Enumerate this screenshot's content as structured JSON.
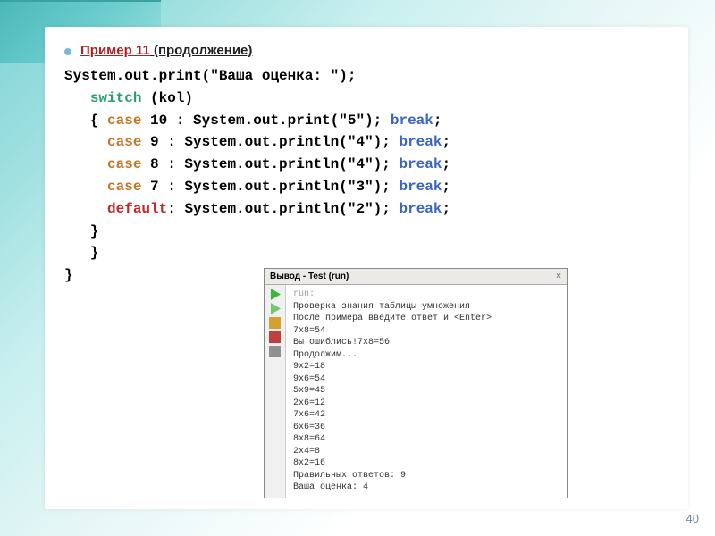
{
  "title": {
    "example_label": "Пример  11",
    "continuation": " (продолжение)"
  },
  "code": {
    "l1": "System.out.print(\"Ваша оценка: \");",
    "l2_kw": "switch",
    "l2_rest": " (kol)",
    "l3_open": "   { ",
    "l3_case": "case",
    "l3_mid": " 10 : System.out.print(\"5\"); ",
    "l3_break": "break",
    "l4_pad": "     ",
    "l4_case": "case",
    "l4_mid": " 9 : System.out.println(\"4\"); ",
    "l4_break": "break",
    "l5_pad": "     ",
    "l5_case": "case",
    "l5_mid": " 8 : System.out.println(\"4\"); ",
    "l5_break": "break",
    "l6_pad": "     ",
    "l6_case": "case",
    "l6_mid": " 7 : System.out.println(\"3\"); ",
    "l6_break": "break",
    "l7_pad": "     ",
    "l7_default": "default",
    "l7_mid": ": System.out.println(\"2\"); ",
    "l7_break": "break",
    "semicolon": ";",
    "l8": "   }",
    "l9": "   }",
    "l10": "}"
  },
  "output": {
    "tab_label": "Вывод - Test (run)",
    "tab_close": "×",
    "run_label": "run:",
    "lines": [
      "Проверка знания таблицы умножения",
      "После примера введите ответ и <Enter>",
      "7x8=54",
      "Вы ошиблись!7x8=56",
      "Продолжим...",
      "9x2=18",
      "9x6=54",
      "5x9=45",
      "2x6=12",
      "7x6=42",
      "6x6=36",
      "8x8=64",
      "2x4=8",
      "8x2=16",
      "Правильных ответов: 9",
      "Ваша оценка: 4"
    ]
  },
  "slide_number": "40"
}
